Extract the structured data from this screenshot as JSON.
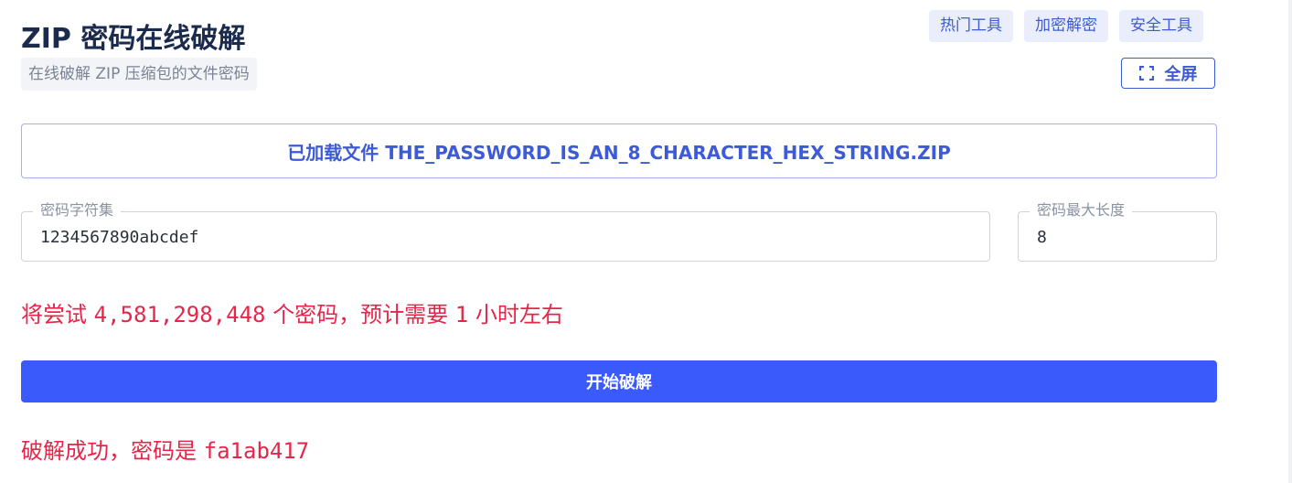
{
  "header": {
    "title": "ZIP 密码在线破解",
    "subtitle": "在线破解 ZIP 压缩包的文件密码"
  },
  "top_links": [
    "热门工具",
    "加密解密",
    "安全工具"
  ],
  "fullscreen": {
    "label": "全屏",
    "icon": "expand-icon"
  },
  "file_box": {
    "text": "已加载文件 THE_PASSWORD_IS_AN_8_CHARACTER_HEX_STRING.ZIP"
  },
  "charset_field": {
    "label": "密码字符集",
    "value": "1234567890abcdef"
  },
  "maxlen_field": {
    "label": "密码最大长度",
    "value": "8"
  },
  "estimate": {
    "prefix": "将尝试",
    "count": "4,581,298,448",
    "middle": "个密码，预计需要",
    "hours": "1",
    "suffix": "小时左右"
  },
  "start_button": {
    "label": "开始破解"
  },
  "result": {
    "prefix": "破解成功，密码是",
    "password": "fa1ab417"
  },
  "colors": {
    "accent": "#3b5afc",
    "link": "#3d5bd7",
    "error": "#e5264a",
    "title": "#1b2b4d"
  }
}
